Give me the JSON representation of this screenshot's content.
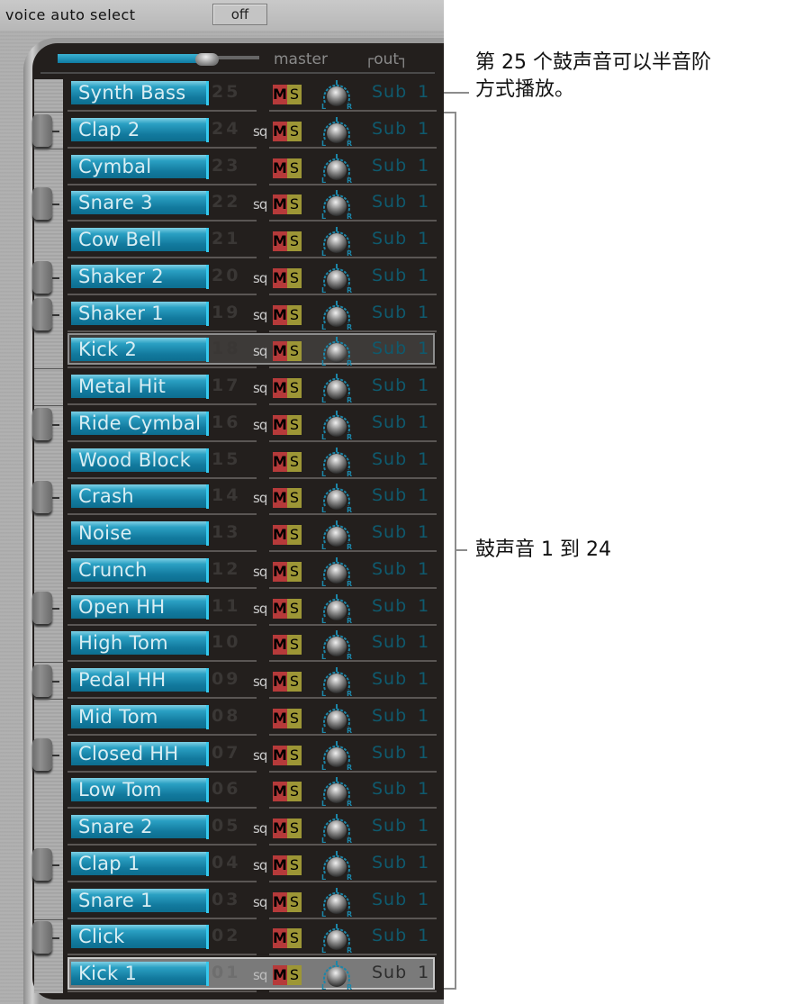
{
  "header": {
    "voice_auto_select_label": "voice auto select",
    "voice_auto_select_value": "off"
  },
  "master": {
    "label": "master",
    "level": 0.72,
    "out_label": "┌out┐"
  },
  "voices": [
    {
      "name": "Synth Bass",
      "number": "25",
      "sq": false,
      "mute": "M",
      "solo": "S",
      "out": [
        "Sub",
        "1"
      ],
      "state": "normal"
    },
    {
      "name": "Clap 2",
      "number": "24",
      "sq": true,
      "mute": "M",
      "solo": "S",
      "out": [
        "Sub",
        "1"
      ],
      "state": "normal"
    },
    {
      "name": "Cymbal",
      "number": "23",
      "sq": false,
      "mute": "M",
      "solo": "S",
      "out": [
        "Sub",
        "1"
      ],
      "state": "normal"
    },
    {
      "name": "Snare 3",
      "number": "22",
      "sq": true,
      "mute": "M",
      "solo": "S",
      "out": [
        "Sub",
        "1"
      ],
      "state": "normal"
    },
    {
      "name": "Cow Bell",
      "number": "21",
      "sq": false,
      "mute": "M",
      "solo": "S",
      "out": [
        "Sub",
        "1"
      ],
      "state": "normal"
    },
    {
      "name": "Shaker 2",
      "number": "20",
      "sq": true,
      "mute": "M",
      "solo": "S",
      "out": [
        "Sub",
        "1"
      ],
      "state": "normal"
    },
    {
      "name": "Shaker 1",
      "number": "19",
      "sq": true,
      "mute": "M",
      "solo": "S",
      "out": [
        "Sub",
        "1"
      ],
      "state": "normal"
    },
    {
      "name": "Kick 2",
      "number": "18",
      "sq": true,
      "mute": "M",
      "solo": "S",
      "out": [
        "Sub",
        "1"
      ],
      "state": "outlined"
    },
    {
      "name": "Metal Hit",
      "number": "17",
      "sq": true,
      "mute": "M",
      "solo": "S",
      "out": [
        "Sub",
        "1"
      ],
      "state": "normal"
    },
    {
      "name": "Ride Cymbal",
      "number": "16",
      "sq": true,
      "mute": "M",
      "solo": "S",
      "out": [
        "Sub",
        "1"
      ],
      "state": "normal"
    },
    {
      "name": "Wood Block",
      "number": "15",
      "sq": false,
      "mute": "M",
      "solo": "S",
      "out": [
        "Sub",
        "1"
      ],
      "state": "normal"
    },
    {
      "name": "Crash",
      "number": "14",
      "sq": true,
      "mute": "M",
      "solo": "S",
      "out": [
        "Sub",
        "1"
      ],
      "state": "normal"
    },
    {
      "name": "Noise",
      "number": "13",
      "sq": false,
      "mute": "M",
      "solo": "S",
      "out": [
        "Sub",
        "1"
      ],
      "state": "normal"
    },
    {
      "name": "Crunch",
      "number": "12",
      "sq": true,
      "mute": "M",
      "solo": "S",
      "out": [
        "Sub",
        "1"
      ],
      "state": "normal"
    },
    {
      "name": "Open HH",
      "number": "11",
      "sq": true,
      "mute": "M",
      "solo": "S",
      "out": [
        "Sub",
        "1"
      ],
      "state": "normal"
    },
    {
      "name": "High Tom",
      "number": "10",
      "sq": false,
      "mute": "M",
      "solo": "S",
      "out": [
        "Sub",
        "1"
      ],
      "state": "normal"
    },
    {
      "name": "Pedal HH",
      "number": "09",
      "sq": true,
      "mute": "M",
      "solo": "S",
      "out": [
        "Sub",
        "1"
      ],
      "state": "normal"
    },
    {
      "name": "Mid Tom",
      "number": "08",
      "sq": false,
      "mute": "M",
      "solo": "S",
      "out": [
        "Sub",
        "1"
      ],
      "state": "normal"
    },
    {
      "name": "Closed HH",
      "number": "07",
      "sq": true,
      "mute": "M",
      "solo": "S",
      "out": [
        "Sub",
        "1"
      ],
      "state": "normal"
    },
    {
      "name": "Low Tom",
      "number": "06",
      "sq": false,
      "mute": "M",
      "solo": "S",
      "out": [
        "Sub",
        "1"
      ],
      "state": "normal"
    },
    {
      "name": "Snare 2",
      "number": "05",
      "sq": true,
      "mute": "M",
      "solo": "S",
      "out": [
        "Sub",
        "1"
      ],
      "state": "normal"
    },
    {
      "name": "Clap 1",
      "number": "04",
      "sq": true,
      "mute": "M",
      "solo": "S",
      "out": [
        "Sub",
        "1"
      ],
      "state": "normal"
    },
    {
      "name": "Snare 1",
      "number": "03",
      "sq": true,
      "mute": "M",
      "solo": "S",
      "out": [
        "Sub",
        "1"
      ],
      "state": "normal"
    },
    {
      "name": "Click",
      "number": "02",
      "sq": false,
      "mute": "M",
      "solo": "S",
      "out": [
        "Sub",
        "1"
      ],
      "state": "normal"
    },
    {
      "name": "Kick 1",
      "number": "01",
      "sq": true,
      "mute": "M",
      "solo": "S",
      "out": [
        "Sub",
        "1"
      ],
      "state": "selected"
    }
  ],
  "sq_label": "sq",
  "knob_labels": {
    "left": "L",
    "right": "R"
  },
  "annotations": {
    "voice25": "第 25 个鼓声音可以半音阶方式播放。",
    "voice25_line1": "第 25 个鼓声音可以半音阶",
    "voice25_line2": "方式播放。",
    "voices1to24": "鼓声音 1 到 24"
  }
}
